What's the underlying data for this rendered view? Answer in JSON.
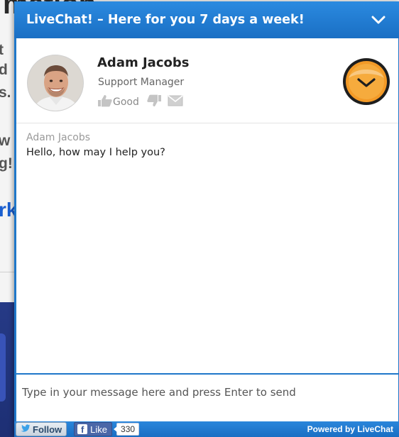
{
  "background_page": {
    "heading_fragment": "mation",
    "text_fragments": [
      "t",
      "d",
      "s.",
      "w",
      "g!"
    ],
    "link_fragment": "rk"
  },
  "chat": {
    "title": "LiveChat! – Here for you 7 days a week!",
    "minimize_icon": "chevron-down-icon",
    "agent": {
      "name": "Adam Jacobs",
      "role": "Support Manager",
      "rate_good_label": "Good",
      "icons": [
        "thumbs-up-icon",
        "thumbs-down-icon",
        "envelope-icon",
        "clock-icon"
      ]
    },
    "messages": [
      {
        "author": "Adam Jacobs",
        "text": "Hello, how may I help you?"
      }
    ],
    "input": {
      "placeholder": "Type in your message here and press Enter to send",
      "value": ""
    },
    "footer": {
      "follow_label": "Follow",
      "like_label": "Like",
      "like_count": "330",
      "powered_by": "Powered by LiveChat"
    }
  },
  "colors": {
    "header_blue": "#1f77c9",
    "timer_orange": "#f39a27",
    "facebook_blue": "#4b67a8"
  }
}
